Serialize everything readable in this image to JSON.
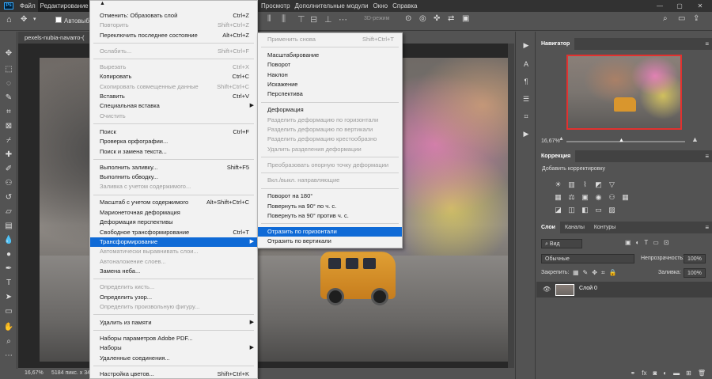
{
  "menubar": {
    "logo": "Ps",
    "items": [
      "Файл",
      "Редактирование"
    ],
    "right_items": [
      "Просмотр",
      "Дополнительные модули",
      "Окно",
      "Справка"
    ],
    "window_controls": [
      "—",
      "▢",
      "✕"
    ]
  },
  "options_bar": {
    "auto_select_label": "Автовыбо",
    "mode_3d": "3D-режим"
  },
  "document": {
    "tab_title": "pexels-nubia-navarro-(",
    "zoom": "16,67%",
    "dimensions": "5184 пикс. x 34"
  },
  "edit_menu": {
    "top_arrow": "▲",
    "groups": [
      [
        {
          "label": "Отменить: Образовать слой",
          "shortcut": "Ctrl+Z",
          "disabled": false
        },
        {
          "label": "Повторить",
          "shortcut": "Shift+Ctrl+Z",
          "disabled": true
        },
        {
          "label": "Переключить последнее состояние",
          "shortcut": "Alt+Ctrl+Z",
          "disabled": false
        }
      ],
      [
        {
          "label": "Ослабить...",
          "shortcut": "Shift+Ctrl+F",
          "disabled": true
        }
      ],
      [
        {
          "label": "Вырезать",
          "shortcut": "Ctrl+X",
          "disabled": true
        },
        {
          "label": "Копировать",
          "shortcut": "Ctrl+C",
          "disabled": false
        },
        {
          "label": "Скопировать совмещенные данные",
          "shortcut": "Shift+Ctrl+C",
          "disabled": true
        },
        {
          "label": "Вставить",
          "shortcut": "Ctrl+V",
          "disabled": false
        },
        {
          "label": "Специальная вставка",
          "submenu": true,
          "disabled": false
        },
        {
          "label": "Очистить",
          "disabled": true
        }
      ],
      [
        {
          "label": "Поиск",
          "shortcut": "Ctrl+F",
          "disabled": false
        },
        {
          "label": "Проверка орфографии...",
          "disabled": false
        },
        {
          "label": "Поиск и замена текста...",
          "disabled": false
        }
      ],
      [
        {
          "label": "Выполнить заливку...",
          "shortcut": "Shift+F5",
          "disabled": false
        },
        {
          "label": "Выполнить обводку...",
          "disabled": false
        },
        {
          "label": "Заливка с учетом содержимого...",
          "disabled": true
        }
      ],
      [
        {
          "label": "Масштаб с учетом содержимого",
          "shortcut": "Alt+Shift+Ctrl+C",
          "disabled": false
        },
        {
          "label": "Марионеточная деформация",
          "disabled": false
        },
        {
          "label": "Деформация перспективы",
          "disabled": false
        },
        {
          "label": "Свободное трансформирование",
          "shortcut": "Ctrl+T",
          "disabled": false
        },
        {
          "label": "Трансформирование",
          "submenu": true,
          "selected": true,
          "disabled": false
        },
        {
          "label": "Автоматически выравнивать слои...",
          "disabled": true
        },
        {
          "label": "Автоналожение слоев...",
          "disabled": true
        },
        {
          "label": "Замена неба...",
          "disabled": false
        }
      ],
      [
        {
          "label": "Определить кисть...",
          "disabled": true
        },
        {
          "label": "Определить узор...",
          "disabled": false
        },
        {
          "label": "Определить произвольную фигуру...",
          "disabled": true
        }
      ],
      [
        {
          "label": "Удалить из памяти",
          "submenu": true,
          "disabled": false
        }
      ],
      [
        {
          "label": "Наборы параметров Adobe PDF...",
          "disabled": false
        },
        {
          "label": "Наборы",
          "submenu": true,
          "disabled": false
        },
        {
          "label": "Удаленные соединения...",
          "disabled": false
        }
      ],
      [
        {
          "label": "Настройка цветов...",
          "shortcut": "Shift+Ctrl+K",
          "disabled": false
        }
      ]
    ]
  },
  "transform_submenu": {
    "groups": [
      [
        {
          "label": "Применить снова",
          "shortcut": "Shift+Ctrl+T",
          "disabled": true
        }
      ],
      [
        {
          "label": "Масштабирование",
          "disabled": false
        },
        {
          "label": "Поворот",
          "disabled": false
        },
        {
          "label": "Наклон",
          "disabled": false
        },
        {
          "label": "Искажение",
          "disabled": false
        },
        {
          "label": "Перспектива",
          "disabled": false
        }
      ],
      [
        {
          "label": "Деформация",
          "disabled": false
        },
        {
          "label": "Разделить деформацию по горизонтали",
          "disabled": true
        },
        {
          "label": "Разделить деформацию по вертикали",
          "disabled": true
        },
        {
          "label": "Разделить деформацию крестообразно",
          "disabled": true
        },
        {
          "label": "Удалить разделения деформации",
          "disabled": true
        }
      ],
      [
        {
          "label": "Преобразовать опорную точку деформации",
          "disabled": true
        }
      ],
      [
        {
          "label": "Вкл./выкл. направляющие",
          "disabled": true
        }
      ],
      [
        {
          "label": "Поворот на 180°",
          "disabled": false
        },
        {
          "label": "Повернуть на 90° по ч. с.",
          "disabled": false
        },
        {
          "label": "Повернуть на 90° против ч. с.",
          "disabled": false
        }
      ],
      [
        {
          "label": "Отразить по горизонтали",
          "selected": true,
          "disabled": false
        },
        {
          "label": "Отразить по вертикали",
          "disabled": false
        }
      ]
    ]
  },
  "navigator": {
    "tab": "Навигатор",
    "zoom": "16,67%"
  },
  "corrections": {
    "tab": "Коррекция",
    "hint": "Добавить корректировку"
  },
  "layers": {
    "tabs": [
      "Слои",
      "Каналы",
      "Контуры"
    ],
    "filter": "Вид",
    "blend_mode": "Обычные",
    "opacity_label": "Непрозрачность:",
    "opacity_value": "100%",
    "lock_label": "Закрепить:",
    "fill_label": "Заливка:",
    "fill_value": "100%",
    "items": [
      {
        "name": "Слой 0"
      }
    ]
  }
}
